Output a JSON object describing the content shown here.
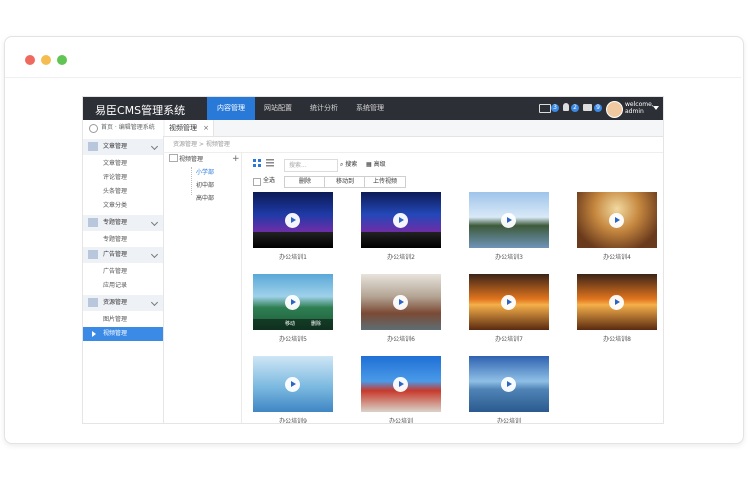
{
  "app": {
    "brand": "易臣CMS管理系统",
    "nav": [
      "内容管理",
      "网站配置",
      "统计分析",
      "系统管理"
    ],
    "active_nav": 0,
    "badges": [
      "3",
      "2",
      "9"
    ],
    "user": {
      "greeting": "welcome,",
      "name": "admin"
    }
  },
  "sidebar": {
    "breadcrumb": "首页 · 编辑管理系统",
    "groups": [
      {
        "label": "文章管理",
        "items": [
          "文章管理",
          "评论管理",
          "头条管理",
          "文章分类"
        ]
      },
      {
        "label": "专题管理",
        "items": [
          "专题管理"
        ]
      },
      {
        "label": "广告管理",
        "items": [
          "广告管理",
          "应用记录"
        ]
      },
      {
        "label": "资源管理",
        "items": [
          "图片管理",
          "视频管理"
        ]
      }
    ],
    "active_item": "视频管理"
  },
  "tab": {
    "label": "视频管理",
    "close": "×"
  },
  "page_breadcrumb": "资源管理 > 视频管理",
  "tree": {
    "root": "视频管理",
    "children": [
      "小学部",
      "初中部",
      "高中部"
    ],
    "selected": "小学部"
  },
  "toolbar": {
    "search_placeholder": "搜索...",
    "search_label": "搜索",
    "advanced_label": "高级",
    "select_all": "全选",
    "buttons": [
      "删除",
      "移动到",
      "上传视频"
    ]
  },
  "videos": [
    {
      "title": "办公培训1"
    },
    {
      "title": "办公培训2"
    },
    {
      "title": "办公培训3"
    },
    {
      "title": "办公培训4"
    },
    {
      "title": "办公培训5"
    },
    {
      "title": "办公培训6"
    },
    {
      "title": "办公培训7"
    },
    {
      "title": "办公培训8"
    },
    {
      "title": "办公培训9"
    },
    {
      "title": "办公培训"
    },
    {
      "title": "办公培训"
    }
  ],
  "hover_actions": [
    "移动",
    "删除"
  ],
  "colors": {
    "topbar": "#2c2f36",
    "accent": "#2979d9",
    "active_sub": "#3b8ae6"
  }
}
